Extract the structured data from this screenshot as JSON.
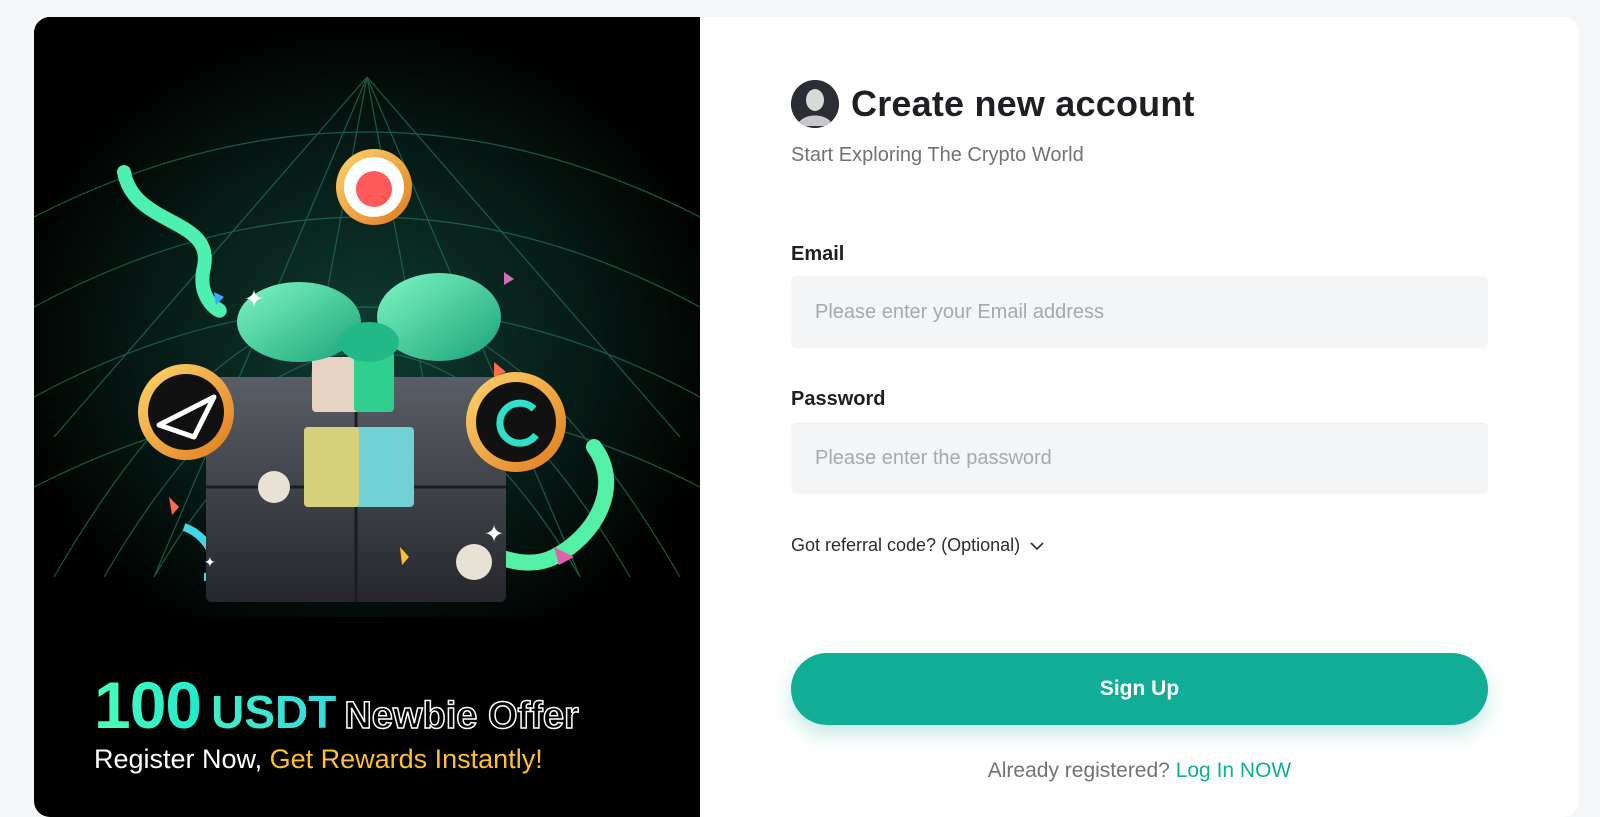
{
  "promo": {
    "amount": "100",
    "unit": "USDT",
    "tagline": "Newbie Offer",
    "sub_prefix": "Register Now, ",
    "sub_highlight": "Get Rewards Instantly!",
    "colors": {
      "accent_green": "#3ff0c8",
      "highlight_yellow": "#ffc02e",
      "background": "#000000"
    }
  },
  "form": {
    "title": "Create new account",
    "subtitle": "Start Exploring The Crypto World",
    "email": {
      "label": "Email",
      "placeholder": "Please enter your Email address",
      "value": ""
    },
    "password": {
      "label": "Password",
      "placeholder": "Please enter the password",
      "value": ""
    },
    "referral_label": "Got referral code? (Optional)",
    "signup_label": "Sign Up",
    "already_text": "Already registered?",
    "login_link": "Log In NOW",
    "accent_color": "#12ad96"
  }
}
